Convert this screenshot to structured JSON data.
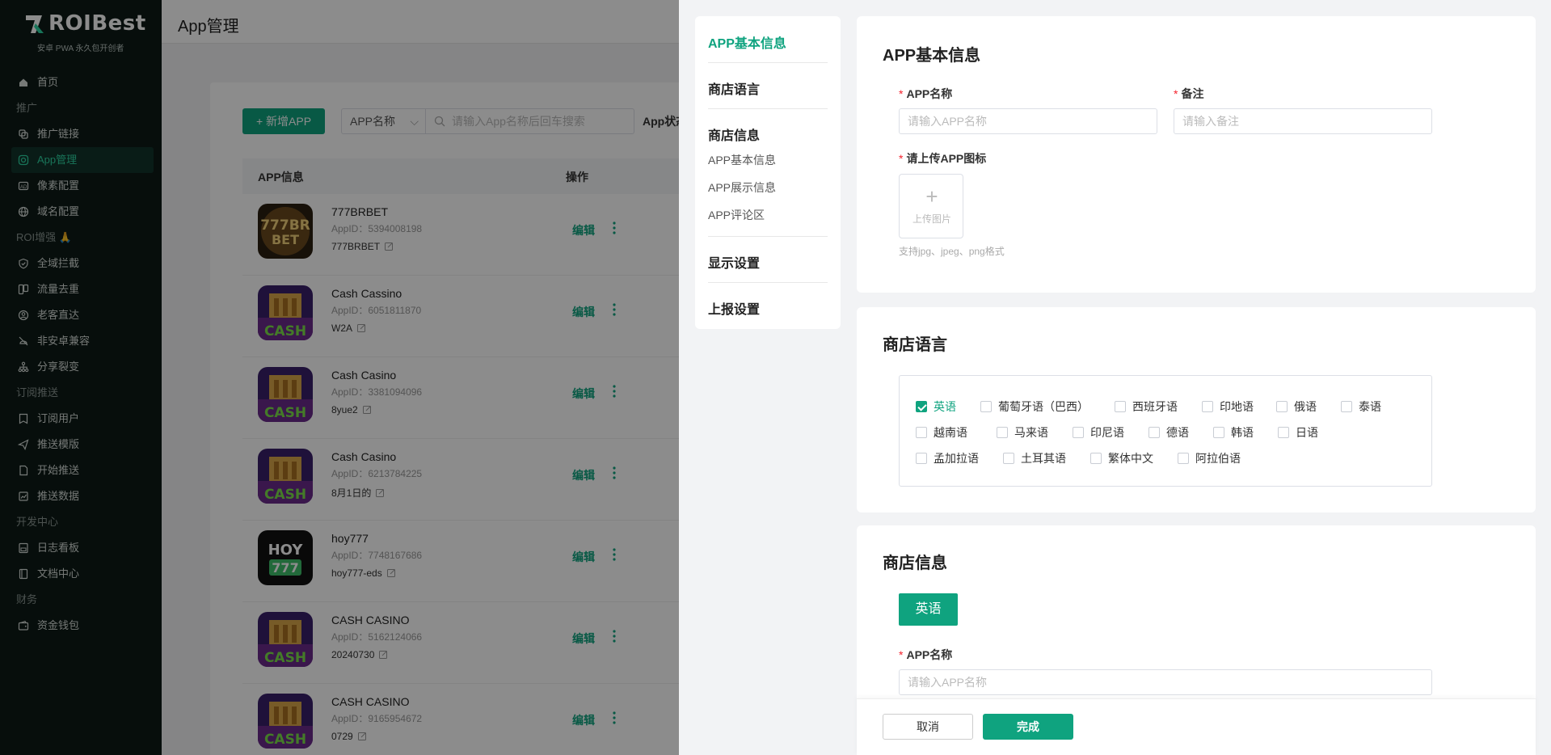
{
  "brand": {
    "name_prefix": "R",
    "name_mid": "OI",
    "name_suffix": "Best",
    "tagline": "安卓 PWA 永久包开创者"
  },
  "sidebar": {
    "items": [
      {
        "type": "item",
        "label": "首页",
        "icon": "home-icon"
      },
      {
        "type": "group",
        "label": "推广"
      },
      {
        "type": "item",
        "label": "推广链接",
        "icon": "link-icon"
      },
      {
        "type": "item",
        "label": "App管理",
        "icon": "app-icon",
        "active": true
      },
      {
        "type": "item",
        "label": "像素配置",
        "icon": "ad-icon"
      },
      {
        "type": "item",
        "label": "域名配置",
        "icon": "globe-icon"
      },
      {
        "type": "group",
        "label": "ROI增强 🙏"
      },
      {
        "type": "item",
        "label": "全域拦截",
        "icon": "shield-icon"
      },
      {
        "type": "item",
        "label": "流量去重",
        "icon": "copy-icon"
      },
      {
        "type": "item",
        "label": "老客直达",
        "icon": "user-icon"
      },
      {
        "type": "item",
        "label": "非安卓兼容",
        "icon": "compat-icon"
      },
      {
        "type": "item",
        "label": "分享裂变",
        "icon": "share-icon"
      },
      {
        "type": "group",
        "label": "订阅推送"
      },
      {
        "type": "item",
        "label": "订阅用户",
        "icon": "subscribe-icon"
      },
      {
        "type": "item",
        "label": "推送模版",
        "icon": "send-icon"
      },
      {
        "type": "item",
        "label": "开始推送",
        "icon": "doc-icon"
      },
      {
        "type": "item",
        "label": "推送数据",
        "icon": "chart-icon"
      },
      {
        "type": "group",
        "label": "开发中心"
      },
      {
        "type": "item",
        "label": "日志看板",
        "icon": "log-icon"
      },
      {
        "type": "item",
        "label": "文档中心",
        "icon": "book-icon"
      },
      {
        "type": "group",
        "label": "财务"
      },
      {
        "type": "item",
        "label": "资金钱包",
        "icon": "wallet-icon"
      }
    ]
  },
  "header": {
    "title": "App管理"
  },
  "toolbar": {
    "add_label": "+ 新增APP",
    "filter_value": "APP名称",
    "search_placeholder": "请输入App名称后回车搜索",
    "status_label": "App状态"
  },
  "table": {
    "col_info": "APP信息",
    "col_action": "操作",
    "edit_label": "编辑",
    "rows": [
      {
        "name": "777BRBET",
        "app_id": "AppID：5394008198",
        "note": "777BRBET",
        "icon": "brbet"
      },
      {
        "name": "Cash Cassino",
        "app_id": "AppID：6051811870",
        "note": "W2A",
        "icon": "cash"
      },
      {
        "name": "Cash Casino",
        "app_id": "AppID：3381094096",
        "note": "8yue2",
        "icon": "cash"
      },
      {
        "name": "Cash Casino",
        "app_id": "AppID：6213784225",
        "note": "8月1日的",
        "icon": "cash"
      },
      {
        "name": "hoy777",
        "app_id": "AppID：7748167686",
        "note": "hoy777-eds",
        "icon": "hoy"
      },
      {
        "name": "CASH CASINO",
        "app_id": "AppID：5162124066",
        "note": "20240730",
        "icon": "cash"
      },
      {
        "name": "CASH CASINO",
        "app_id": "AppID：9165954672",
        "note": "0729",
        "icon": "cash"
      }
    ]
  },
  "drawer": {
    "anchors": {
      "basic": "APP基本信息",
      "store_lang": "商店语言",
      "store_info": "商店信息",
      "sub_basic": "APP基本信息",
      "sub_display": "APP展示信息",
      "sub_review": "APP评论区",
      "display": "显示设置",
      "report": "上报设置"
    },
    "basic": {
      "title": "APP基本信息",
      "name_label": "APP名称",
      "name_placeholder": "请输入APP名称",
      "note_label": "备注",
      "note_placeholder": "请输入备注",
      "icon_label": "请上传APP图标",
      "upload_text": "上传图片",
      "upload_hint": "支持jpg、jpeg、png格式"
    },
    "store_lang": {
      "title": "商店语言",
      "languages": [
        {
          "label": "英语",
          "checked": true
        },
        {
          "label": "葡萄牙语（巴西）",
          "checked": false
        },
        {
          "label": "西班牙语",
          "checked": false
        },
        {
          "label": "印地语",
          "checked": false
        },
        {
          "label": "俄语",
          "checked": false
        },
        {
          "label": "泰语",
          "checked": false
        },
        {
          "label": "越南语",
          "checked": false
        },
        {
          "label": "马来语",
          "checked": false
        },
        {
          "label": "印尼语",
          "checked": false
        },
        {
          "label": "德语",
          "checked": false
        },
        {
          "label": "韩语",
          "checked": false
        },
        {
          "label": "日语",
          "checked": false
        },
        {
          "label": "孟加拉语",
          "checked": false
        },
        {
          "label": "土耳其语",
          "checked": false
        },
        {
          "label": "繁体中文",
          "checked": false
        },
        {
          "label": "阿拉伯语",
          "checked": false
        }
      ]
    },
    "store_info": {
      "title": "商店信息",
      "tab_label": "英语",
      "name_label": "APP名称",
      "name_placeholder": "请输入APP名称"
    },
    "footer": {
      "cancel": "取消",
      "done": "完成"
    }
  },
  "colors": {
    "accent": "#0fa37f",
    "sidebar_bg": "#0d1b17",
    "required": "#f5222d"
  }
}
